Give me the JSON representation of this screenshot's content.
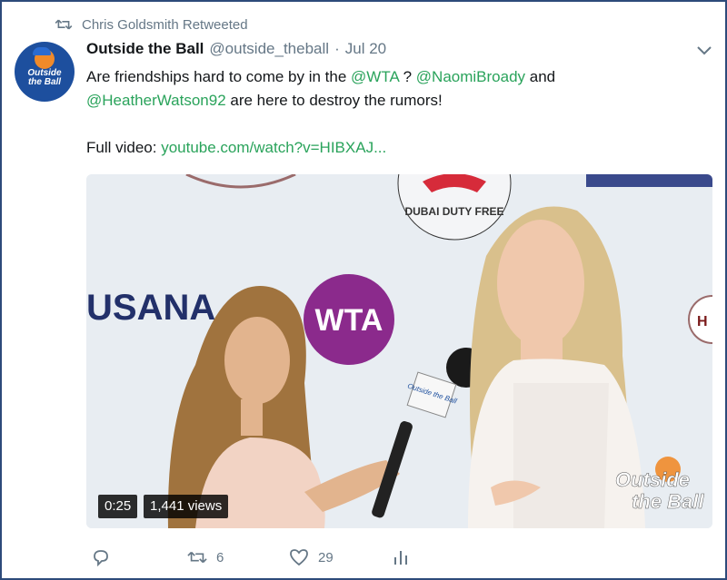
{
  "retweet_context": {
    "text": "Chris Goldsmith Retweeted"
  },
  "author": {
    "name": "Outside the Ball",
    "handle": "@outside_theball",
    "separator": "·",
    "date": "Jul 20",
    "avatar_text_line1": "Outside",
    "avatar_text_line2": "the Ball"
  },
  "tweet": {
    "line1_pre": "Are friendships hard to come by in the ",
    "mention_wta": "@WTA",
    "line1_mid": " ? ",
    "mention_naomi": "@NaomiBroady",
    "line1_post": " and",
    "mention_heather": "@HeatherWatson92",
    "line2_post": " are here to destroy the rumors!",
    "video_label": "Full video: ",
    "video_link": "youtube.com/watch?v=HIBXAJ..."
  },
  "video": {
    "duration": "0:25",
    "views": "1,441 views",
    "backdrop_logos": {
      "wta": "WTA",
      "usana": "USANA",
      "dubai": "DUBAI DUTY FREE",
      "partial_right": "H"
    },
    "mic_flag_text": "Outside the Ball",
    "watermark_line1": "Outside",
    "watermark_line2": "the Ball"
  },
  "actions": {
    "reply_count": "",
    "retweet_count": "6",
    "like_count": "29"
  },
  "colors": {
    "mention": "#2aa35b",
    "muted": "#657786",
    "frame_border": "#2d4a7a",
    "wta_purple": "#8b2a8c"
  }
}
